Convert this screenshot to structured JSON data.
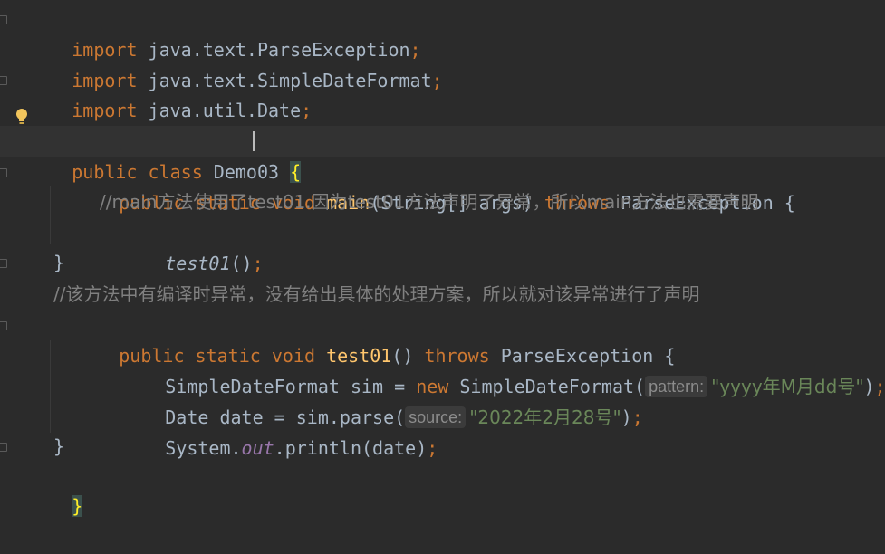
{
  "code": {
    "l1": {
      "k": "import",
      "a": " java.text.ParseException",
      "s": ";"
    },
    "l2": {
      "k": "import",
      "a": " java.text.SimpleDateFormat",
      "s": ";"
    },
    "l3": {
      "k": "import",
      "a": " java.util.Date",
      "s": ";"
    },
    "l5": {
      "k1": "public",
      "k2": "class",
      "name": " Demo03 ",
      "brace": "{"
    },
    "l6": {
      "k1": "public",
      "k2": "static",
      "k3": "void",
      "fn": "main",
      "args": "(String[] args) ",
      "k4": "throws",
      "tail": " ParseException {"
    },
    "l7": {
      "comment": "//main方法使用了test01.因为test01方法声明了异常，所以main方法也需要声明"
    },
    "l8": {
      "call": "test01",
      "paren": "()",
      "s": ";"
    },
    "l9": {
      "brace": "}"
    },
    "l10": {
      "comment": "//该方法中有编译时异常，没有给出具体的处理方案，所以就对该异常进行了声明"
    },
    "l11": {
      "k1": "public",
      "k2": "static",
      "k3": "void",
      "fn": "test01",
      "args": "() ",
      "k4": "throws",
      "tail": " ParseException {"
    },
    "l12": {
      "a": "SimpleDateFormat sim = ",
      "k": "new",
      "b": " SimpleDateFormat(",
      "hint": "pattern:",
      "str": "\"yyyy年M月dd号\"",
      "end": ")",
      "s": ";"
    },
    "l13": {
      "a": "Date date = sim.parse(",
      "hint": "source:",
      "str": "\"2022年2月28号\"",
      "end": ")",
      "s": ";"
    },
    "l14": {
      "a": "System.",
      "field": "out",
      "b": ".println(date)",
      "s": ";"
    },
    "l15": {
      "brace": "}"
    },
    "l16": {
      "brace": "}"
    }
  },
  "colors": {
    "background": "#2b2b2b",
    "keyword": "#cc7832",
    "function": "#ffc66d",
    "string": "#6a8759",
    "comment": "#808080",
    "field": "#9876aa"
  },
  "icons": {
    "gutter": "lightbulb-icon"
  }
}
